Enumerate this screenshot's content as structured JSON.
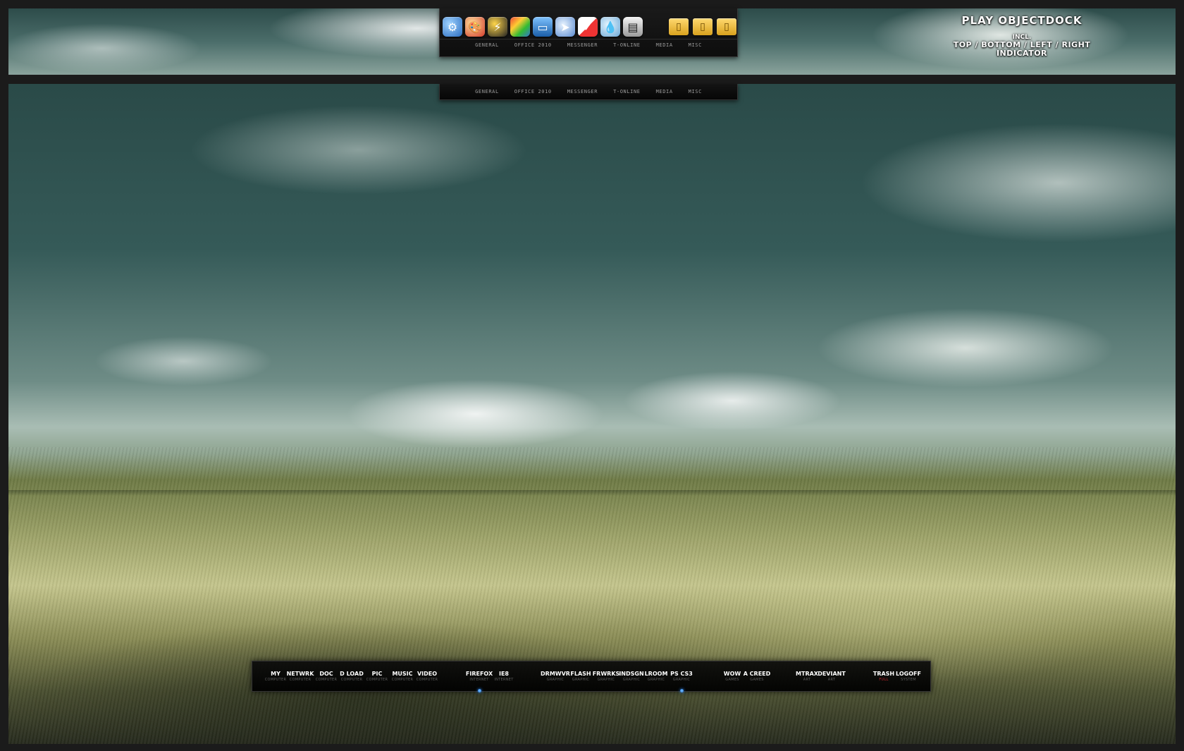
{
  "top_dock": {
    "icons": [
      "settings-icon",
      "paint-palette-icon",
      "flash-bolt-icon",
      "color-bars-icon",
      "monitor-icon",
      "cursor-icon",
      "checklist-icon",
      "water-drop-icon",
      "clipboard-icon"
    ],
    "folders": [
      "folder-icon",
      "folder-icon",
      "folder-icon"
    ],
    "tabs": [
      "GENERAL",
      "OFFICE 2010",
      "MESSENGER",
      "T-ONLINE",
      "MEDIA",
      "MISC"
    ]
  },
  "caption": {
    "title": "PLAY OBJECTDOCK",
    "incl": "INCL.",
    "line1": "TOP / BOTTOM / LEFT / RIGHT",
    "line2": "INDICATOR"
  },
  "bottom_dock": {
    "items": [
      {
        "label": "MY",
        "sub": "COMPUTER",
        "active": false
      },
      {
        "label": "NETWRK",
        "sub": "COMPUTER",
        "active": false
      },
      {
        "label": "DOC",
        "sub": "COMPUTER",
        "active": false
      },
      {
        "label": "D LOAD",
        "sub": "COMPUTER",
        "active": false
      },
      {
        "label": "PIC",
        "sub": "COMPUTER",
        "active": false
      },
      {
        "label": "MUSIC",
        "sub": "COMPUTER",
        "active": false
      },
      {
        "label": "VIDEO",
        "sub": "COMPUTER",
        "active": false
      },
      {
        "label": "FIREFOX",
        "sub": "INTERNET",
        "active": true
      },
      {
        "label": "IE8",
        "sub": "INTERNET",
        "active": false
      },
      {
        "label": "DRMWVR",
        "sub": "GRAPHIC",
        "active": false
      },
      {
        "label": "FLASH",
        "sub": "GRAPHIC",
        "active": false
      },
      {
        "label": "FRWRKS",
        "sub": "GRAPHIC",
        "active": false
      },
      {
        "label": "INDSGN",
        "sub": "GRAPHIC",
        "active": false
      },
      {
        "label": "LROOM",
        "sub": "GRAPHIC",
        "active": false
      },
      {
        "label": "PS CS3",
        "sub": "GRAPHIC",
        "active": true
      },
      {
        "label": "WOW",
        "sub": "GAMES",
        "active": false
      },
      {
        "label": "A CREED",
        "sub": "GAMES",
        "active": false
      },
      {
        "label": "MTRAX",
        "sub": "ART",
        "active": false
      },
      {
        "label": "DEVIANT",
        "sub": "ART",
        "active": false
      },
      {
        "label": "TRASH",
        "sub": "FULL",
        "active": false,
        "sub_color": "red"
      },
      {
        "label": "LOGOFF",
        "sub": "SYSTEM",
        "active": false
      }
    ]
  }
}
